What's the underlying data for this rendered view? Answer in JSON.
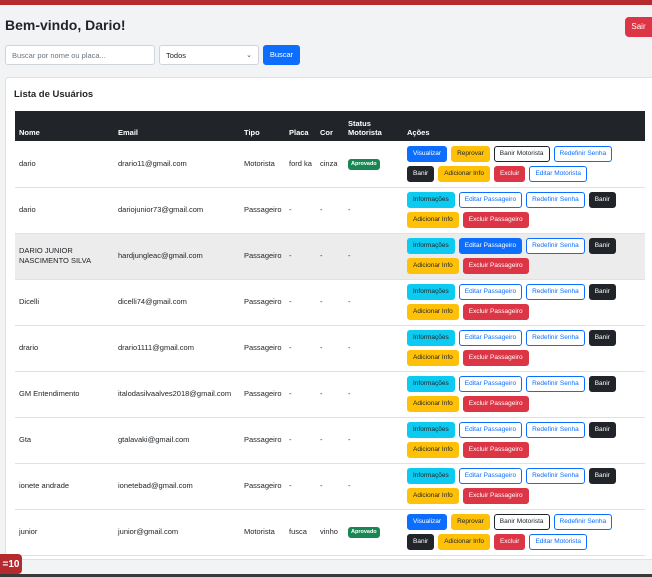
{
  "header": {
    "welcome": "Bem-vindo, Dario!",
    "logout_label": "Sair"
  },
  "filters": {
    "search_placeholder": "Buscar por nome ou placa...",
    "type_selected": "Todos",
    "search_button": "Buscar"
  },
  "card": {
    "title": "Lista de Usuários"
  },
  "table": {
    "headers": {
      "nome": "Nome",
      "email": "Email",
      "tipo": "Tipo",
      "placa": "Placa",
      "cor": "Cor",
      "status": "Status Motorista",
      "acoes": "Ações"
    },
    "rows": [
      {
        "nome": "dario",
        "email": "drario11@gmail.com",
        "tipo": "Motorista",
        "placa": "ford ka",
        "cor": "cinza",
        "status": "Aprovado",
        "kind": "motorista",
        "actions": [
          "Visualizar",
          "Reprovar",
          "Banir Motorista",
          "Redefinir Senha",
          "Banir",
          "Adicionar Info",
          "Excluir",
          "Editar Motorista"
        ]
      },
      {
        "nome": "dario",
        "email": "dariojunior73@gmail.com",
        "tipo": "Passageiro",
        "placa": "-",
        "cor": "-",
        "status": "-",
        "kind": "passageiro",
        "actions": [
          "Informações",
          "Editar Passageiro",
          "Redefinir Senha",
          "Banir",
          "Adicionar Info",
          "Excluir Passageiro"
        ]
      },
      {
        "nome": "DARIO JUNIOR NASCIMENTO SILVA",
        "email": "hardjungleac@gmail.com",
        "tipo": "Passageiro",
        "placa": "-",
        "cor": "-",
        "status": "-",
        "kind": "passageiro-hover",
        "actions": [
          "Informações",
          "Editar Passageiro",
          "Redefinir Senha",
          "Banir",
          "Adicionar Info",
          "Excluir Passageiro"
        ]
      },
      {
        "nome": "Dicelli",
        "email": "dicelli74@gmail.com",
        "tipo": "Passageiro",
        "placa": "-",
        "cor": "-",
        "status": "-",
        "kind": "passageiro",
        "actions": [
          "Informações",
          "Editar Passageiro",
          "Redefinir Senha",
          "Banir",
          "Adicionar Info",
          "Excluir Passageiro"
        ]
      },
      {
        "nome": "drario",
        "email": "drario1111@gmail.com",
        "tipo": "Passageiro",
        "placa": "-",
        "cor": "-",
        "status": "-",
        "kind": "passageiro",
        "actions": [
          "Informações",
          "Editar Passageiro",
          "Redefinir Senha",
          "Banir",
          "Adicionar Info",
          "Excluir Passageiro"
        ]
      },
      {
        "nome": "GM Entendimento",
        "email": "italodasilvaalves2018@gmail.com",
        "tipo": "Passageiro",
        "placa": "-",
        "cor": "-",
        "status": "-",
        "kind": "passageiro",
        "actions": [
          "Informações",
          "Editar Passageiro",
          "Redefinir Senha",
          "Banir",
          "Adicionar Info",
          "Excluir Passageiro"
        ]
      },
      {
        "nome": "Gta",
        "email": "gtalavaki@gmail.com",
        "tipo": "Passageiro",
        "placa": "-",
        "cor": "-",
        "status": "-",
        "kind": "passageiro",
        "actions": [
          "Informações",
          "Editar Passageiro",
          "Redefinir Senha",
          "Banir",
          "Adicionar Info",
          "Excluir Passageiro"
        ]
      },
      {
        "nome": "ionete andrade",
        "email": "ionetebad@gmail.com",
        "tipo": "Passageiro",
        "placa": "-",
        "cor": "-",
        "status": "-",
        "kind": "passageiro",
        "actions": [
          "Informações",
          "Editar Passageiro",
          "Redefinir Senha",
          "Banir",
          "Adicionar Info",
          "Excluir Passageiro"
        ]
      },
      {
        "nome": "junior",
        "email": "junior@gmail.com",
        "tipo": "Motorista",
        "placa": "fusca",
        "cor": "vinho",
        "status": "Aprovado",
        "kind": "motorista",
        "actions": [
          "Visualizar",
          "Reprovar",
          "Banir Motorista",
          "Redefinir Senha",
          "Banir",
          "Adicionar Info",
          "Excluir",
          "Editar Motorista"
        ]
      }
    ]
  },
  "overlay": {
    "timestamp_fragment": "=10"
  },
  "colors": {
    "accent_red": "#b52a2f",
    "primary": "#0d6efd",
    "success": "#198754"
  }
}
